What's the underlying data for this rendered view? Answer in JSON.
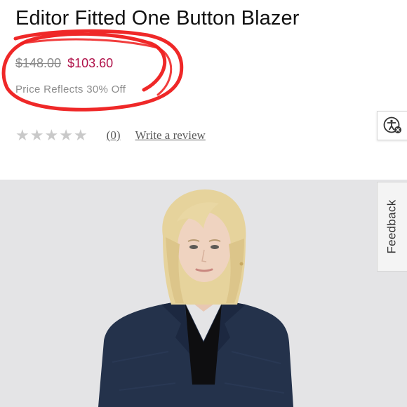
{
  "product": {
    "title": "Editor Fitted One Button Blazer",
    "original_price": "$148.00",
    "sale_price": "$103.60",
    "discount_note": "Price Reflects 30% Off",
    "sale_color": "#b0124a",
    "annotation_color": "#ee1c1c"
  },
  "rating": {
    "stars_total": 5,
    "stars_filled": 0,
    "review_count": "(0)",
    "write_review": "Write a review"
  },
  "widgets": {
    "accessibility_icon": "accessibility-person-icon",
    "feedback_label": "Feedback"
  },
  "image": {
    "description_icon": "model-photo",
    "background": "#e4e4e6"
  }
}
